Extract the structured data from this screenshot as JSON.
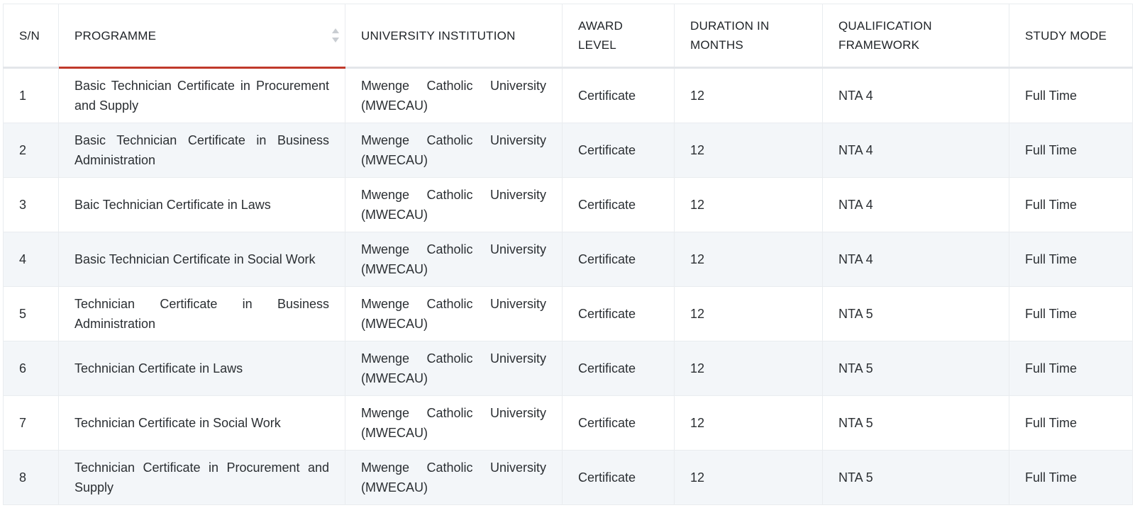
{
  "table": {
    "headers": [
      "S/N",
      "PROGRAMME",
      "UNIVERSITY INSTITUTION",
      "AWARD LEVEL",
      "DURATION IN MONTHS",
      "QUALIFICATION FRAMEWORK",
      "STUDY MODE"
    ],
    "rows": [
      [
        "1",
        "Basic Technician Certificate in Procurement and Supply",
        "Mwenge Catholic University (MWECAU)",
        "Certificate",
        "12",
        "NTA 4",
        "Full Time"
      ],
      [
        "2",
        "Basic Technician Certificate in Business Administration",
        "Mwenge Catholic University (MWECAU)",
        "Certificate",
        "12",
        "NTA 4",
        "Full Time"
      ],
      [
        "3",
        "Baic Technician Certificate in Laws",
        "Mwenge Catholic University (MWECAU)",
        "Certificate",
        "12",
        "NTA 4",
        "Full Time"
      ],
      [
        "4",
        "Basic Technician Certificate in Social Work",
        "Mwenge Catholic University (MWECAU)",
        "Certificate",
        "12",
        "NTA 4",
        "Full Time"
      ],
      [
        "5",
        "Technician Certificate in Business Administration",
        "Mwenge Catholic University (MWECAU)",
        "Certificate",
        "12",
        "NTA 5",
        "Full Time"
      ],
      [
        "6",
        "Technician Certificate in Laws",
        "Mwenge Catholic University (MWECAU)",
        "Certificate",
        "12",
        "NTA 5",
        "Full Time"
      ],
      [
        "7",
        "Technician Certificate in Social Work",
        "Mwenge Catholic University (MWECAU)",
        "Certificate",
        "12",
        "NTA 5",
        "Full Time"
      ],
      [
        "8",
        "Technician Certificate in Procurement and Supply",
        "Mwenge Catholic University (MWECAU)",
        "Certificate",
        "12",
        "NTA 5",
        "Full Time"
      ]
    ]
  },
  "icons": {
    "sort": "sort-icon"
  },
  "colors": {
    "sorted_underline": "#c0392b",
    "stripe": "#f3f6f9",
    "border": "#e9ecef"
  }
}
